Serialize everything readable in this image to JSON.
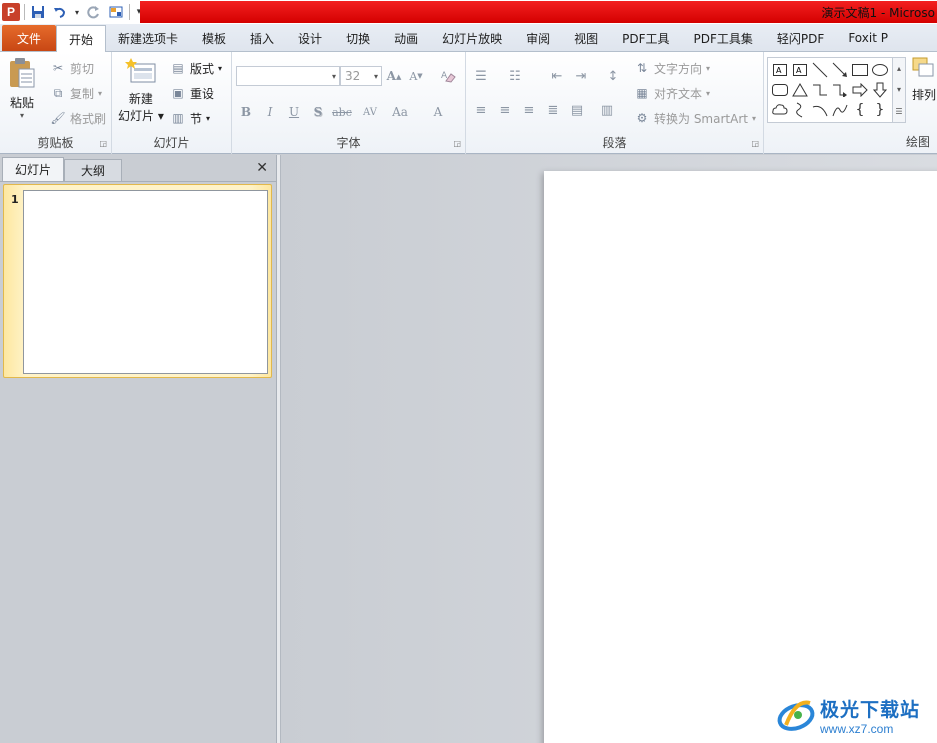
{
  "titlebar": {
    "app_logo": "P",
    "title": "演示文稿1 - Microso",
    "qat_icons": [
      "save-icon",
      "undo-icon",
      "redo-icon",
      "layout-icon",
      "customize-icon"
    ]
  },
  "tabs": [
    "文件",
    "开始",
    "新建选项卡",
    "模板",
    "插入",
    "设计",
    "切换",
    "动画",
    "幻灯片放映",
    "审阅",
    "视图",
    "PDF工具",
    "PDF工具集",
    "轻闪PDF",
    "Foxit P"
  ],
  "active_tab": "开始",
  "clipboard": {
    "paste": "粘贴",
    "cut": "剪切",
    "copy": "复制",
    "format_painter": "格式刷",
    "label": "剪贴板"
  },
  "slides_group": {
    "new_slide_line1": "新建",
    "new_slide_line2": "幻灯片",
    "layout": "版式",
    "reset": "重设",
    "section": "节",
    "label": "幻灯片"
  },
  "font_group": {
    "font_name": "",
    "font_size": "32",
    "label": "字体",
    "format_buttons": [
      "B",
      "I",
      "U",
      "S",
      "abc",
      "AV",
      "Aa",
      "A"
    ]
  },
  "paragraph_group": {
    "text_direction": "文字方向",
    "align_text": "对齐文本",
    "convert_smartart": "转换为 SmartArt",
    "label": "段落"
  },
  "drawing_group": {
    "arrange": "排列",
    "label": "绘图"
  },
  "slide_panel": {
    "tab_slides": "幻灯片",
    "tab_outline": "大纲",
    "close": "✕",
    "thumb_number": "1"
  },
  "watermark": {
    "name": "极光下载站",
    "url": "www.xz7.com"
  },
  "colors": {
    "accent_red": "#e00000",
    "file_tab": "#d95a20",
    "selection_gold": "#fde7a0"
  }
}
